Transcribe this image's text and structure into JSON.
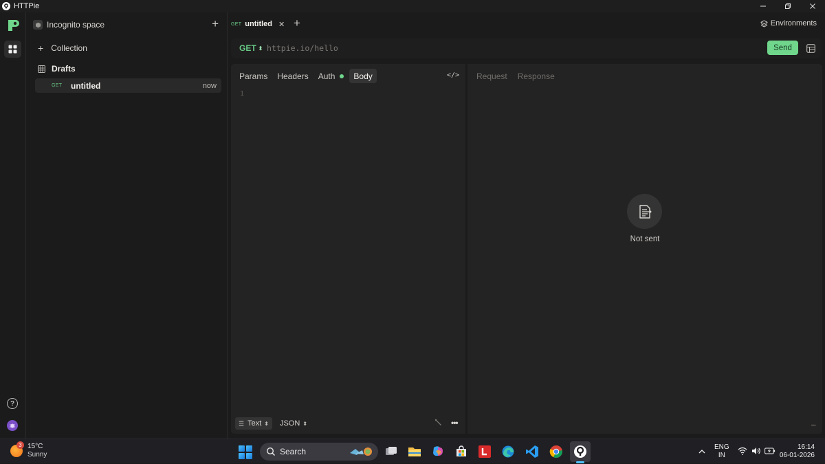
{
  "window": {
    "title": "HTTPie"
  },
  "sidebar": {
    "space_name": "Incognito space",
    "collection_label": "Collection",
    "drafts_label": "Drafts",
    "draft_item": {
      "method": "GET",
      "name": "untitled",
      "time": "now"
    }
  },
  "tabs": [
    {
      "method": "GET",
      "name": "untitled"
    }
  ],
  "environments_label": "Environments",
  "request": {
    "method": "GET",
    "url_placeholder": "httpie.io/hello",
    "send_label": "Send",
    "tabs": [
      "Params",
      "Headers",
      "Auth",
      "Body"
    ],
    "active_tab": "Body",
    "line_number": "1",
    "body_format": "Text",
    "body_type": "JSON",
    "code_toggle": "</>"
  },
  "response": {
    "tabs": [
      "Request",
      "Response"
    ],
    "status_text": "Not sent"
  },
  "taskbar": {
    "weather_temp": "15°C",
    "weather_condition": "Sunny",
    "weather_badge": "3",
    "search_label": "Search",
    "lang_primary": "ENG",
    "lang_secondary": "IN",
    "time": "16:14",
    "date": "06-01-2026"
  },
  "colors": {
    "accent_green": "#6fd68c",
    "method_green": "#67c987",
    "background": "#1c1b1b",
    "panel": "#242323"
  }
}
